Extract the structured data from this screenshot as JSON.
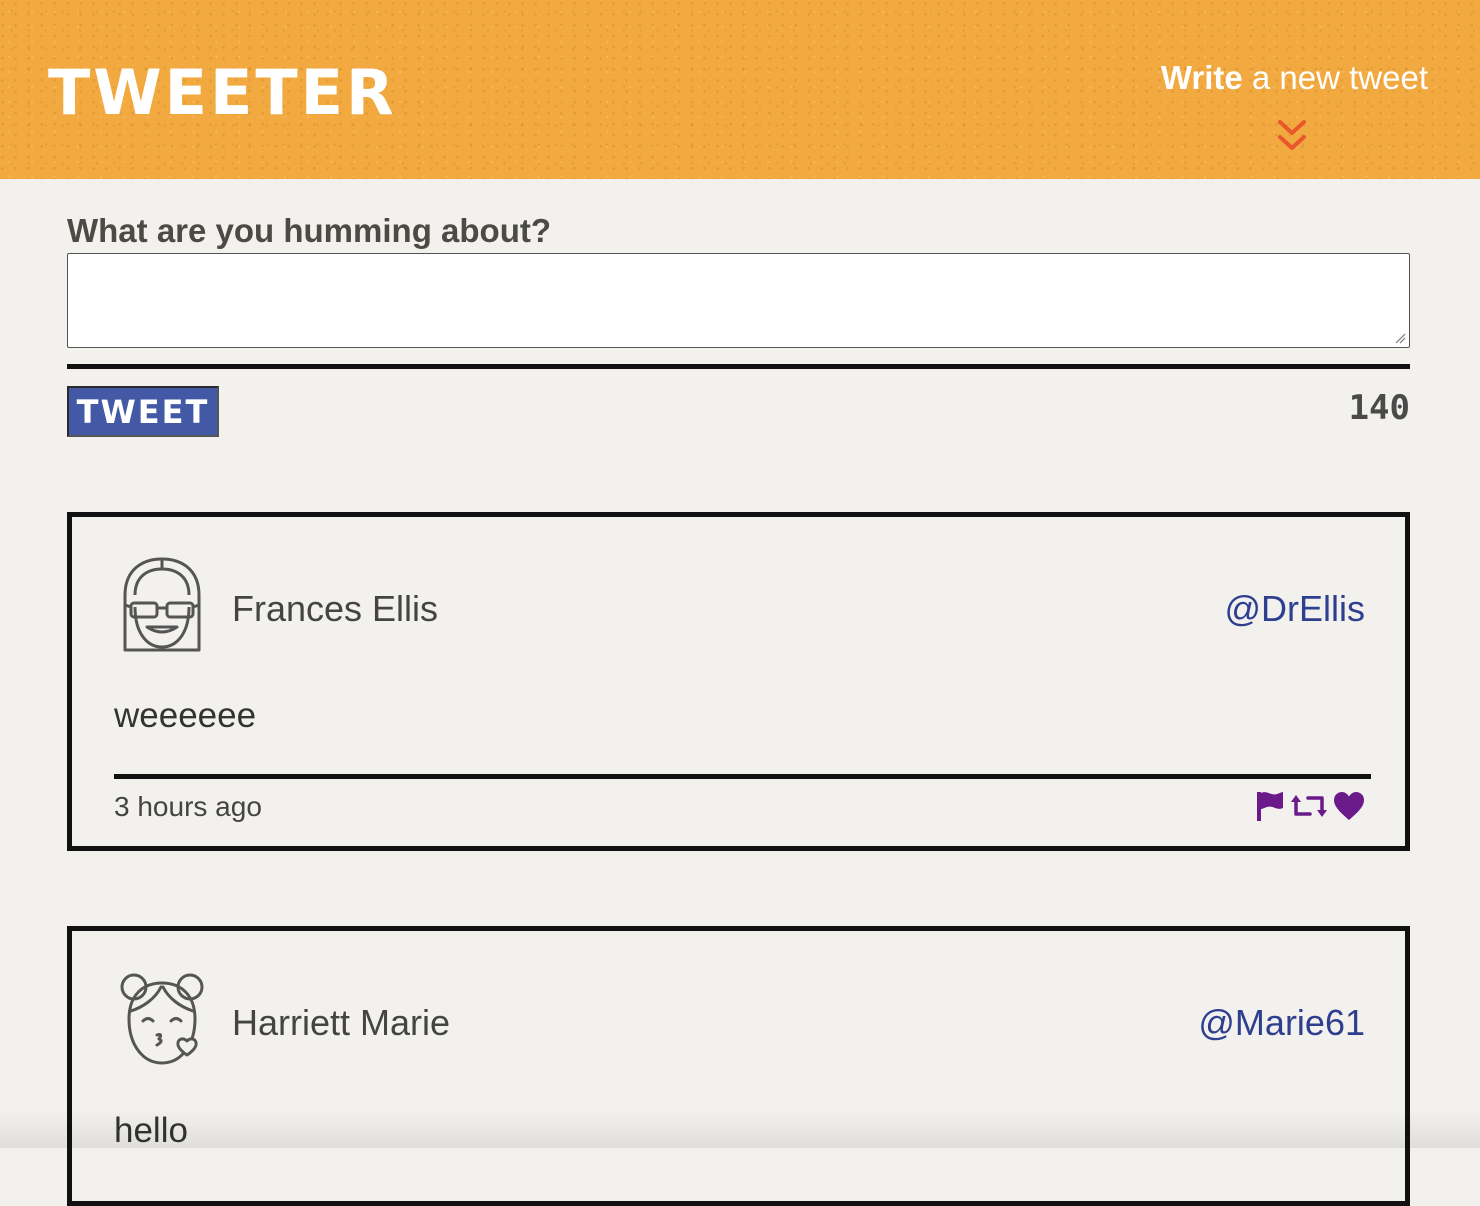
{
  "header": {
    "logo": "TWEETER",
    "write_strong": "Write",
    "write_rest": " a new tweet",
    "chevron_icon": "double-chevron-down-icon"
  },
  "compose": {
    "label": "What are you humming about?",
    "value": "",
    "button_label": "TWEET",
    "counter": "140"
  },
  "colors": {
    "header_bg": "#f2a93f",
    "button_bg": "#4359a6",
    "handle": "#2f3f8f",
    "action_icons": "#6b1a8a",
    "chevron": "#e9572a"
  },
  "tweets": [
    {
      "name": "Frances Ellis",
      "handle": "@DrEllis",
      "text": "weeeeee",
      "time": "3 hours ago",
      "avatar_icon": "girl-sunglasses-avatar-icon",
      "actions": [
        "flag-icon",
        "retweet-icon",
        "heart-icon"
      ]
    },
    {
      "name": "Harriett Marie",
      "handle": "@Marie61",
      "text": "hello",
      "avatar_icon": "girl-kiss-avatar-icon"
    }
  ]
}
